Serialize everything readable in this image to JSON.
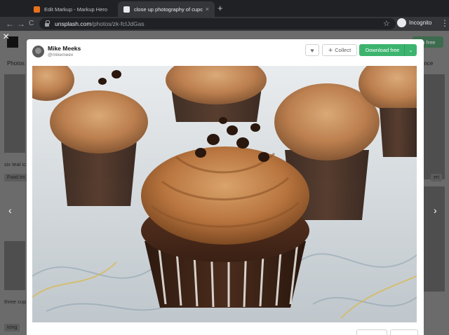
{
  "browser": {
    "tabs": [
      {
        "title": "Edit Markup - Markup Hero",
        "favicon_color": "#e8711a",
        "active": false
      },
      {
        "title": "close up photography of cupca",
        "favicon_color": "#111111",
        "active": true
      }
    ],
    "new_tab": "+",
    "url_host": "unsplash.com",
    "url_path": "/photos/zk-fcIJdGas",
    "profile_label": "Incognito",
    "nav": {
      "back": "←",
      "forward": "→",
      "reload": "C"
    },
    "star_icon": "☆",
    "menu_icon": "⋮"
  },
  "background_page": {
    "close_icon": "×",
    "right_button": "in free",
    "tab_label": "Photos",
    "sort_label": "ance",
    "item_labels": [
      "six teal ic",
      "Food Im",
      "three cup",
      "icing"
    ],
    "right_tag": "ert",
    "prev_icon": "‹",
    "next_icon": "›"
  },
  "modal": {
    "author": {
      "name": "Mike Meeks",
      "handle": "@mikemeex"
    },
    "like_icon": "♥",
    "collect_label": "Collect",
    "download_label": "Download free",
    "download_chevron": "⌄",
    "accent_color": "#3cb46e"
  }
}
